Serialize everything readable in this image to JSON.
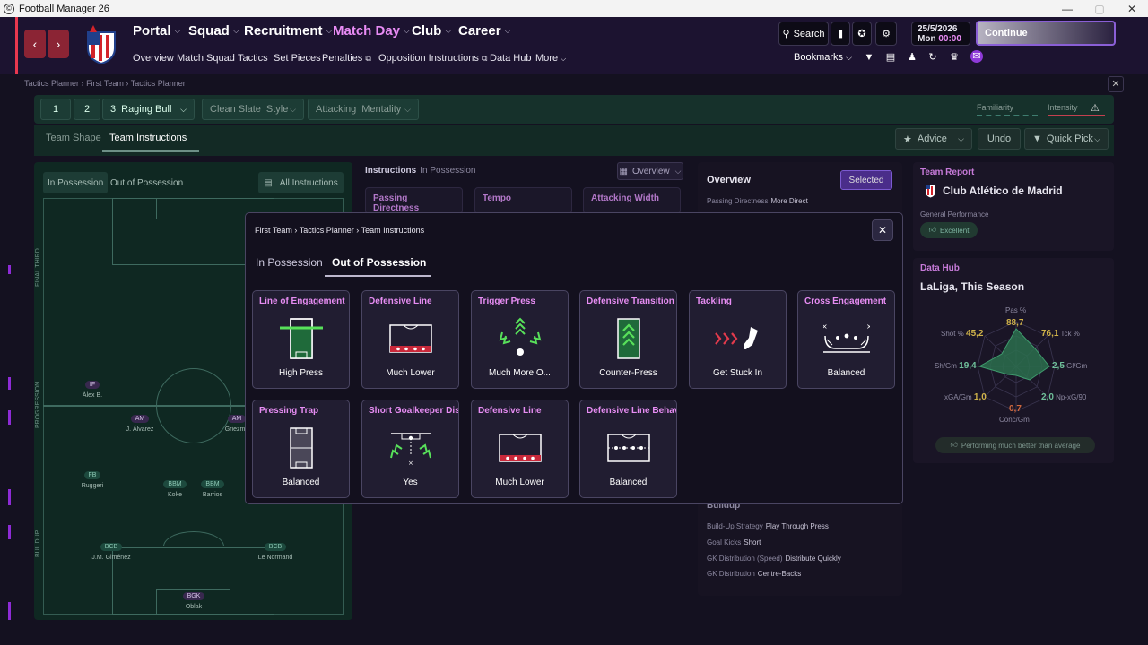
{
  "window": {
    "title": "Football Manager 26"
  },
  "nav": {
    "portal": "Portal",
    "squad": "Squad",
    "recruitment": "Recruitment",
    "match_day": "Match Day",
    "club": "Club",
    "career": "Career",
    "sub": [
      "Overview",
      "Match Squad",
      "Tactics",
      "Set Pieces",
      "Penalties",
      "Opposition Instructions",
      "Data Hub",
      "More"
    ]
  },
  "header": {
    "search": "Search",
    "date": "25/5/2026",
    "day": "Mon",
    "time": "00:00",
    "continue": "Continue",
    "bookmarks": "Bookmarks"
  },
  "breadcrumb": [
    "Tactics Planner",
    "First Team",
    "Tactics Planner"
  ],
  "tactic_bar": {
    "slot1": "1",
    "slot2": "2",
    "slot3_num": "3",
    "slot3_name": "Raging Bull",
    "style_value": "Clean Slate",
    "style_label": "Style",
    "mentality_value": "Attacking",
    "mentality_label": "Mentality",
    "familiarity": "Familiarity",
    "intensity": "Intensity"
  },
  "main_tabs": {
    "team_shape": "Team Shape",
    "team_instructions": "Team Instructions"
  },
  "right_buttons": {
    "advice": "Advice",
    "undo": "Undo",
    "quick_pick": "Quick Pick"
  },
  "pitch_panel": {
    "tab_in": "In Possession",
    "tab_out": "Out of Possession",
    "all_instructions": "All Instructions",
    "zones": {
      "final_third": "FINAL THIRD",
      "progression": "PROGRESSION",
      "buildup": "BUILDUP"
    },
    "players": [
      {
        "pos": "IF",
        "name": "Álex B."
      },
      {
        "pos": "AM",
        "name": "J. Álvarez"
      },
      {
        "pos": "AM",
        "name": "Griezma"
      },
      {
        "pos": "FB",
        "name": "Ruggeri"
      },
      {
        "pos": "BBM",
        "name": "Koke"
      },
      {
        "pos": "BBM",
        "name": "Barrios"
      },
      {
        "pos": "BCB",
        "name": "J.M. Giménez"
      },
      {
        "pos": "BCB",
        "name": "Le Normand"
      },
      {
        "pos": "BGK",
        "name": "Oblak"
      }
    ]
  },
  "instructions": {
    "title": "Instructions",
    "subtitle": "In Possession",
    "view": "Overview",
    "cards_behind": [
      "Passing Directness",
      "Tempo",
      "Attacking Width"
    ]
  },
  "overview": {
    "title": "Overview",
    "selected": "Selected",
    "passing_label": "Passing Directness",
    "passing_value": "More Direct",
    "buildup_title": "Buildup",
    "rows": [
      {
        "label": "Build-Up Strategy",
        "value": "Play Through Press"
      },
      {
        "label": "Goal Kicks",
        "value": "Short"
      },
      {
        "label": "GK Distribution (Speed)",
        "value": "Distribute Quickly"
      },
      {
        "label": "GK Distribution",
        "value": "Centre-Backs"
      }
    ]
  },
  "team_report": {
    "title": "Team Report",
    "club": "Club Atlético de Madrid",
    "perf_label": "General Performance",
    "perf_value": "Excellent"
  },
  "data_hub": {
    "title": "Data Hub",
    "subtitle": "LaLiga, This Season",
    "radar": [
      {
        "label": "Pas %",
        "value": "88,7"
      },
      {
        "label": "Tck %",
        "value": "76,1"
      },
      {
        "label": "Gl/Gm",
        "value": "2,5"
      },
      {
        "label": "Np-xG/90",
        "value": "2,0"
      },
      {
        "label": "Conc/Gm",
        "value": "0,7"
      },
      {
        "label": "xGA/Gm",
        "value": "1,0"
      },
      {
        "label": "Sh/Gm",
        "value": "19,4"
      },
      {
        "label": "Shot %",
        "value": "45,2"
      }
    ],
    "verdict": "Performing much better than average"
  },
  "modal": {
    "breadcrumb": [
      "First Team",
      "Tactics Planner",
      "Team Instructions"
    ],
    "tab_in": "In Possession",
    "tab_out": "Out of Possession",
    "cards": [
      {
        "title": "Line of Engagement",
        "value": "High Press",
        "icon": "line-of-engagement-icon"
      },
      {
        "title": "Defensive Line",
        "value": "Much Lower",
        "icon": "defensive-line-icon"
      },
      {
        "title": "Trigger Press",
        "value": "Much More O...",
        "icon": "trigger-press-icon"
      },
      {
        "title": "Defensive Transition",
        "value": "Counter-Press",
        "icon": "defensive-transition-icon"
      },
      {
        "title": "Tackling",
        "value": "Get Stuck In",
        "icon": "tackling-icon"
      },
      {
        "title": "Cross Engagement",
        "value": "Balanced",
        "icon": "cross-engagement-icon"
      },
      {
        "title": "Pressing Trap",
        "value": "Balanced",
        "icon": "pressing-trap-icon"
      },
      {
        "title": "Short Goalkeeper Distr",
        "value": "Yes",
        "icon": "short-goalkeeper-distribution-icon"
      },
      {
        "title": "Defensive Line",
        "value": "Much Lower",
        "icon": "defensive-line-icon"
      },
      {
        "title": "Defensive Line Behavic",
        "value": "Balanced",
        "icon": "defensive-line-behaviour-icon"
      }
    ]
  }
}
